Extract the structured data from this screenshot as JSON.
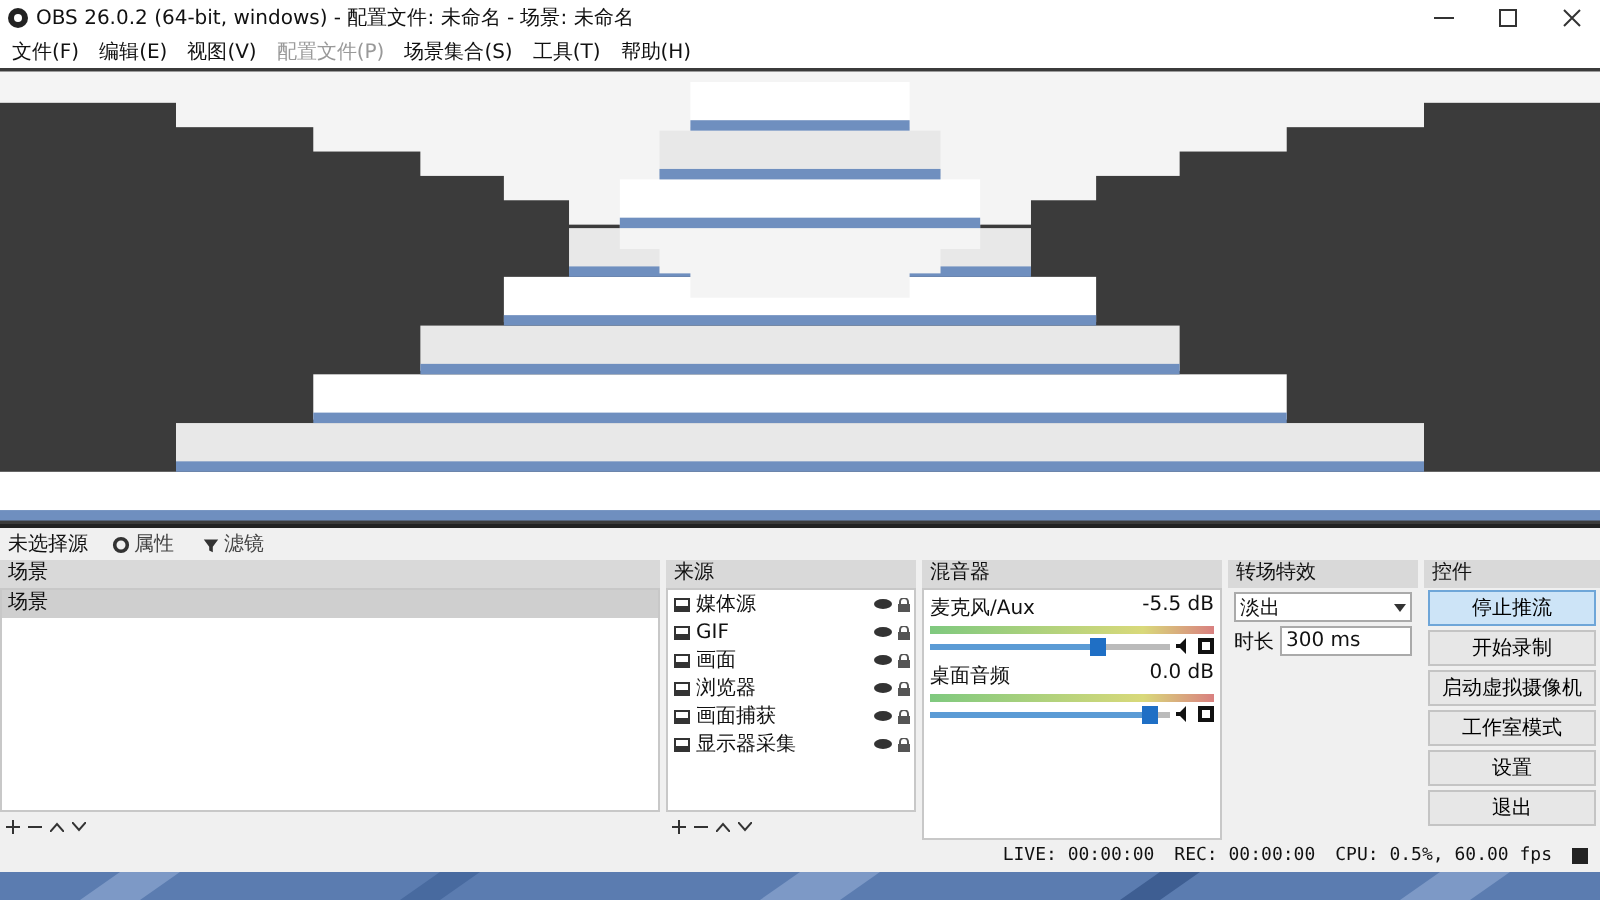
{
  "window": {
    "title": "OBS 26.0.2 (64-bit, windows) - 配置文件: 未命名 - 场景: 未命名"
  },
  "menu": [
    {
      "label": "文件(F)",
      "disabled": false
    },
    {
      "label": "编辑(E)",
      "disabled": false
    },
    {
      "label": "视图(V)",
      "disabled": false
    },
    {
      "label": "配置文件(P)",
      "disabled": true
    },
    {
      "label": "场景集合(S)",
      "disabled": false
    },
    {
      "label": "工具(T)",
      "disabled": false
    },
    {
      "label": "帮助(H)",
      "disabled": false
    }
  ],
  "context_bar": {
    "label": "未选择源",
    "buttons": [
      "属性",
      "滤镜"
    ]
  },
  "scenes": {
    "title": "场景",
    "items": [
      {
        "label": "场景",
        "selected": true
      }
    ]
  },
  "sources": {
    "title": "来源",
    "items": [
      {
        "label": "媒体源"
      },
      {
        "label": "GIF"
      },
      {
        "label": "画面"
      },
      {
        "label": "浏览器"
      },
      {
        "label": "画面捕获"
      },
      {
        "label": "显示器采集"
      }
    ]
  },
  "mixer": {
    "title": "混音器",
    "channels": [
      {
        "name": "麦克风/Aux",
        "reading": "-5.5 dB",
        "level": 0.7
      },
      {
        "name": "桌面音频",
        "reading": "0.0 dB",
        "level": 0.92
      }
    ]
  },
  "transitions": {
    "title": "转场特效",
    "transition": "淡出",
    "duration_label": "时长",
    "duration": "300 ms"
  },
  "controls": {
    "title": "控件",
    "buttons": [
      {
        "label": "停止推流",
        "selected": true
      },
      {
        "label": "开始录制",
        "selected": false
      },
      {
        "label": "启动虚拟摄像机",
        "selected": false
      },
      {
        "label": "工作室模式",
        "selected": false
      },
      {
        "label": "设置",
        "selected": false
      },
      {
        "label": "退出",
        "selected": false
      }
    ]
  },
  "status": {
    "live": "LIVE: 00:00:00",
    "rec": "REC: 00:00:00",
    "cpu": "CPU: 0.5%, 60.00 fps"
  }
}
